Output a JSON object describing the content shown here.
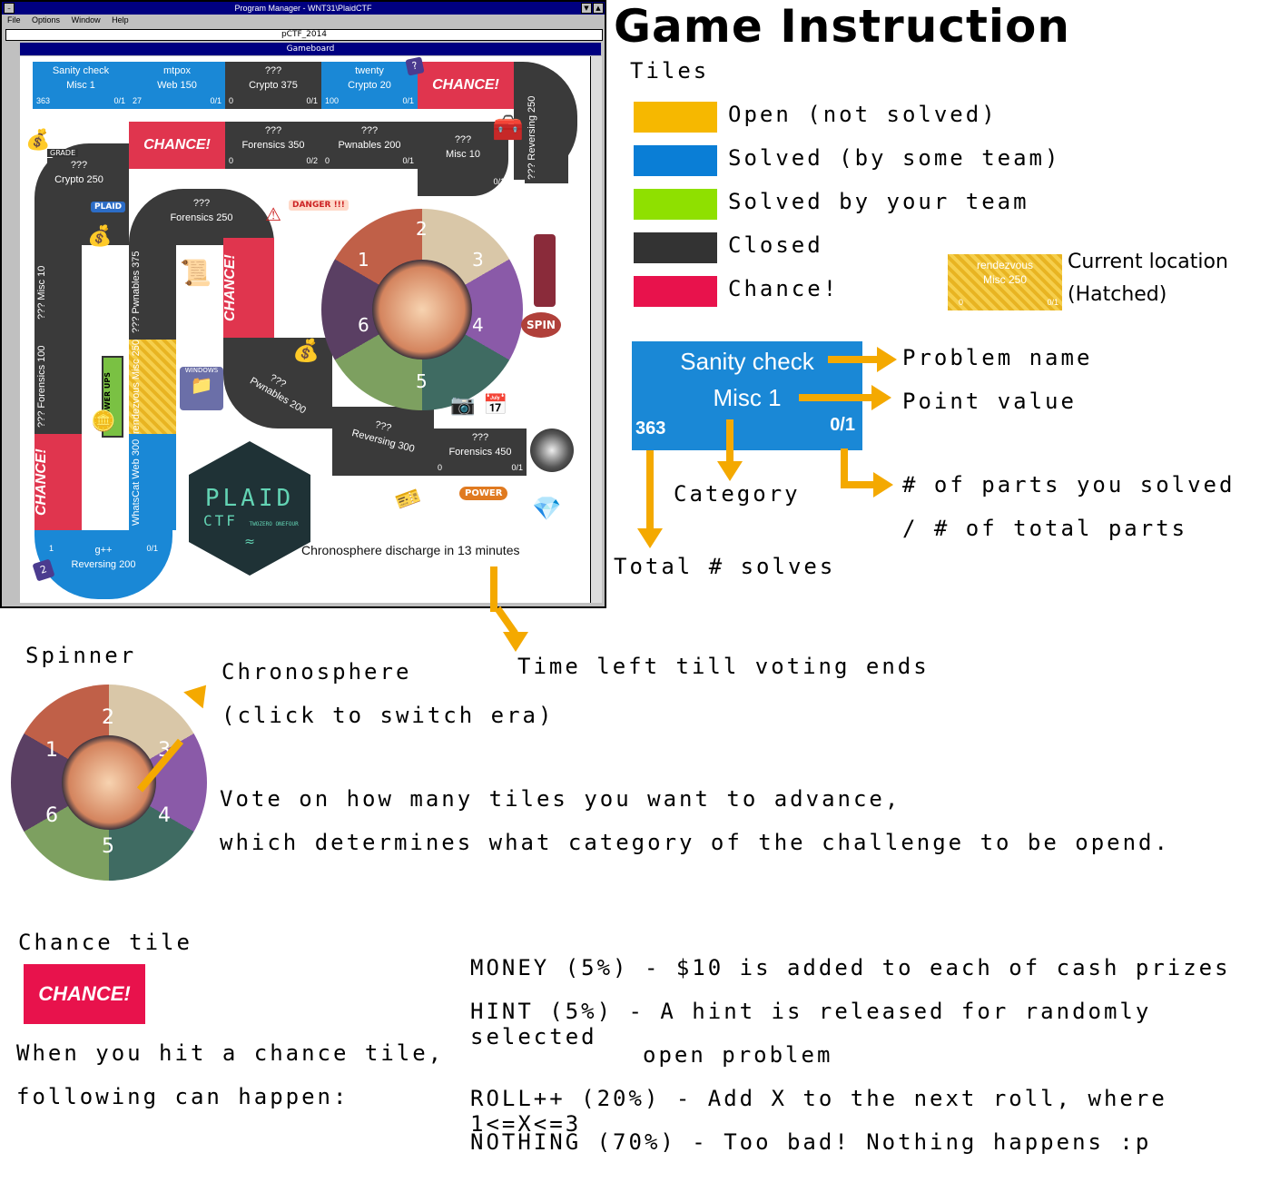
{
  "window": {
    "title": "Program Manager - WNT31\\PlaidCTF",
    "menu": [
      "File",
      "Options",
      "Window",
      "Help"
    ],
    "subwindow_title": "pCTF_2014",
    "board_title": "Gameboard"
  },
  "board": {
    "tiles": [
      {
        "name": "Sanity check",
        "cat": "Misc 1",
        "solves": "363",
        "parts": "0/1"
      },
      {
        "name": "mtpox",
        "cat": "Web 150",
        "solves": "27",
        "parts": "0/1"
      },
      {
        "name": "???",
        "cat": "Crypto 375",
        "solves": "0",
        "parts": "0/1"
      },
      {
        "name": "twenty",
        "cat": "Crypto 20",
        "solves": "100",
        "parts": "0/1"
      },
      {
        "name": "???",
        "cat": "Forensics 350",
        "solves": "0",
        "parts": "0/2"
      },
      {
        "name": "???",
        "cat": "Pwnables 200",
        "solves": "0",
        "parts": "0/1"
      },
      {
        "name": "???",
        "cat": "Misc 10",
        "solves": "0",
        "parts": "0/1"
      },
      {
        "name": "???",
        "cat": "Reversing 250",
        "solves": "0",
        "parts": "0/1"
      },
      {
        "name": "???",
        "cat": "Crypto 250",
        "solves": "0",
        "parts": "0/1"
      },
      {
        "name": "???",
        "cat": "Forensics 250",
        "solves": "0",
        "parts": "0/1"
      },
      {
        "name": "???",
        "cat": "Misc 10",
        "solves": "0",
        "parts": "0/1"
      },
      {
        "name": "???",
        "cat": "Pwnables 375",
        "solves": "0",
        "parts": "0/1"
      },
      {
        "name": "???",
        "cat": "Forensics 100",
        "solves": "0",
        "parts": "0/1"
      },
      {
        "name": "rendezvous",
        "cat": "Misc 250",
        "solves": "0",
        "parts": "0/1"
      },
      {
        "name": "WhatsCat",
        "cat": "Web 300",
        "solves": "1",
        "parts": "0/1"
      },
      {
        "name": "g++",
        "cat": "Reversing 200",
        "solves": "1",
        "parts": "0/1"
      },
      {
        "name": "???",
        "cat": "Pwnables 200",
        "solves": "0",
        "parts": "0/1"
      },
      {
        "name": "???",
        "cat": "Reversing 300",
        "solves": "0",
        "parts": "0/1"
      },
      {
        "name": "???",
        "cat": "Forensics 450",
        "solves": "0",
        "parts": "0/1"
      }
    ],
    "chance_label": "CHANCE!",
    "timer": "Chronosphere discharge in 13 minutes",
    "spinner_numbers": [
      "1",
      "2",
      "3",
      "4",
      "5",
      "6"
    ],
    "badge_q": "?",
    "badge_2": "2",
    "stickers": {
      "danger": "DANGER !!!",
      "plaid": "PLAID",
      "powerups": "POWER UPS",
      "windows": "WINDOWS",
      "power": "POWER",
      "spin": "SPIN",
      "grade": "GRADE"
    },
    "logo": {
      "line1": "PLAID",
      "line2": "CTF",
      "line3": "TWOZERO ONEFOUR"
    }
  },
  "instructions": {
    "title": "Game Instruction",
    "tiles_heading": "Tiles",
    "legend": [
      {
        "label": "Open (not solved)",
        "color": "#f6b800"
      },
      {
        "label": "Solved (by some team)",
        "color": "#0a7ed6"
      },
      {
        "label": "Solved by your team",
        "color": "#8fe000"
      },
      {
        "label": "Closed",
        "color": "#333333"
      },
      {
        "label": "Chance!",
        "color": "#e8124c"
      }
    ],
    "current": {
      "name": "rendezvous",
      "cat": "Misc 250",
      "solves": "0",
      "parts": "0/1",
      "label1": "Current location",
      "label2": "(Hatched)"
    },
    "example": {
      "name": "Sanity check",
      "cat": "Misc 1",
      "solves": "363",
      "parts": "0/1"
    },
    "annotations": {
      "problem_name": "Problem name",
      "point_value": "Point value",
      "category": "Category",
      "parts1": "# of parts you solved",
      "parts2": "/ # of total parts",
      "total": "Total # solves",
      "time_left": "Time left till voting ends"
    },
    "spinner": {
      "heading": "Spinner",
      "chrono1": "Chronosphere",
      "chrono2": "(click to switch era)",
      "vote1": "Vote on how many tiles you want to advance,",
      "vote2": "which determines what category of the challenge to be opend."
    },
    "chance": {
      "heading": "Chance tile",
      "tile": "CHANCE!",
      "desc1": "When you hit a chance tile,",
      "desc2": "following can happen:",
      "items": [
        "MONEY (5%) - $10 is added to each of cash prizes",
        "HINT (5%) - A hint is released for randomly selected",
        "open problem",
        "ROLL++ (20%) - Add X to the next roll, where 1<=X<=3",
        "NOTHING (70%) - Too bad! Nothing happens :p"
      ]
    }
  }
}
